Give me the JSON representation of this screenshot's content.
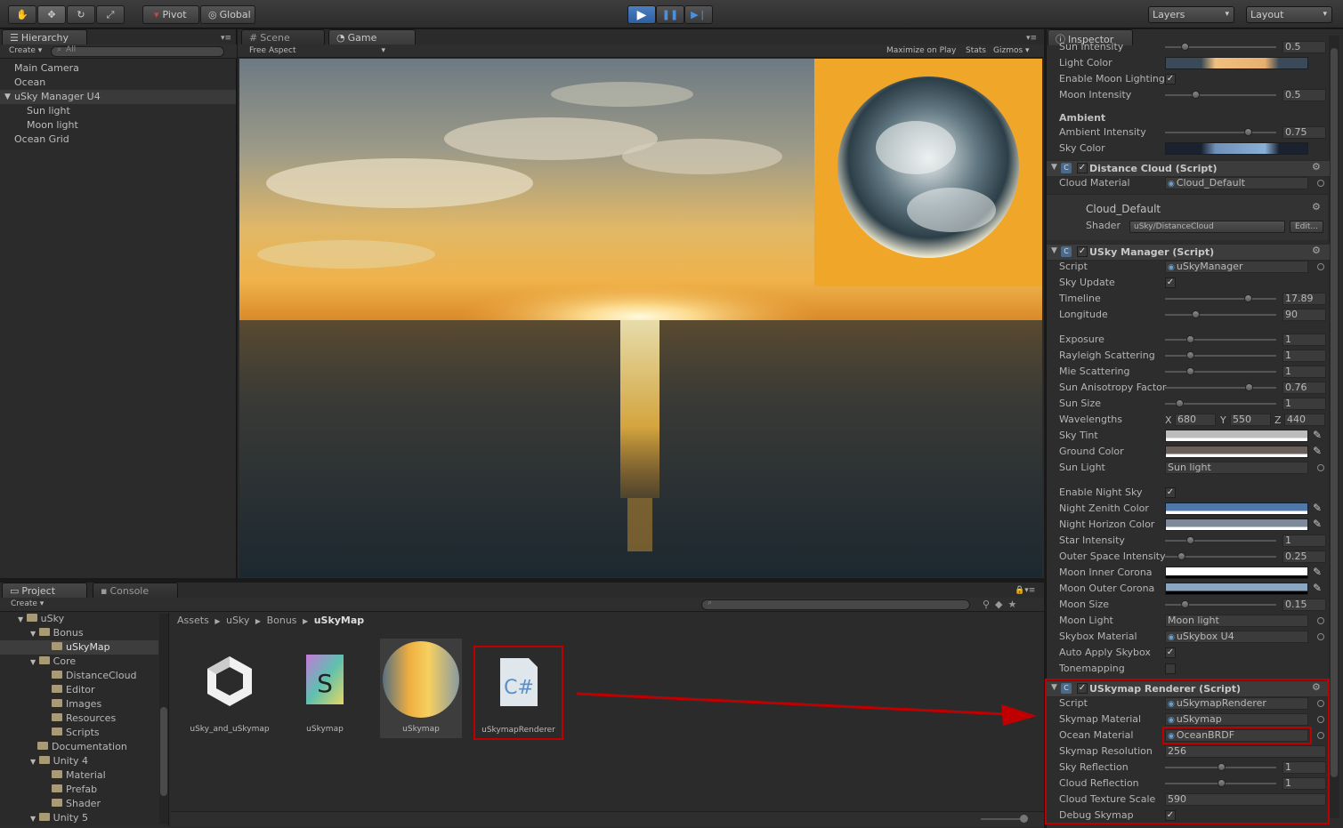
{
  "toolbar": {
    "pivot": "Pivot",
    "global": "Global",
    "layers": "Layers",
    "layout": "Layout"
  },
  "hierarchy": {
    "tab": "Hierarchy",
    "create": "Create",
    "search_placeholder": "All",
    "items": [
      "Main Camera",
      "Ocean",
      "uSky Manager U4",
      "Sun light",
      "Moon light",
      "Ocean Grid"
    ]
  },
  "scene_tab": "Scene",
  "game": {
    "tab": "Game",
    "aspect": "Free Aspect",
    "maximize": "Maximize on Play",
    "stats": "Stats",
    "gizmos": "Gizmos"
  },
  "project": {
    "tab": "Project",
    "console_tab": "Console",
    "create": "Create",
    "tree": [
      "uSky",
      "Bonus",
      "uSkyMap",
      "Core",
      "DistanceCloud",
      "Editor",
      "Images",
      "Resources",
      "Scripts",
      "Documentation",
      "Unity 4",
      "Material",
      "Prefab",
      "Shader",
      "Unity 5"
    ],
    "breadcrumb": [
      "Assets",
      "uSky",
      "Bonus",
      "uSkyMap"
    ],
    "assets": [
      "uSky_and_uSkymap",
      "uSkymap",
      "uSkymap",
      "uSkymapRenderer"
    ]
  },
  "inspector": {
    "tab": "Inspector",
    "rows": [
      {
        "label": "Sun Intensity",
        "value": "0.5"
      },
      {
        "label": "Light Color"
      },
      {
        "label": "Enable Moon Lighting"
      },
      {
        "label": "Moon Intensity",
        "value": "0.5"
      },
      {
        "label": "Ambient"
      },
      {
        "label": "Ambient Intensity",
        "value": "0.75"
      },
      {
        "label": "Sky Color"
      }
    ],
    "distance_cloud": {
      "title": "Distance Cloud (Script)",
      "cloud_material_label": "Cloud Material",
      "cloud_material": "Cloud_Default",
      "material_name": "Cloud_Default",
      "shader_label": "Shader",
      "shader": "uSky/DistanceCloud",
      "edit": "Edit..."
    },
    "manager": {
      "title": "USky Manager (Script)",
      "rows": [
        {
          "label": "Script",
          "field": "uSkyManager"
        },
        {
          "label": "Sky Update"
        },
        {
          "label": "Timeline",
          "value": "17.89"
        },
        {
          "label": "Longitude",
          "value": "90"
        },
        {
          "label": "Exposure",
          "value": "1"
        },
        {
          "label": "Rayleigh Scattering",
          "value": "1"
        },
        {
          "label": "Mie Scattering",
          "value": "1"
        },
        {
          "label": "Sun Anisotropy Factor",
          "value": "0.76"
        },
        {
          "label": "Sun Size",
          "value": "1"
        },
        {
          "label": "Wavelengths"
        },
        {
          "label": "Sky Tint"
        },
        {
          "label": "Ground Color"
        },
        {
          "label": "Sun Light",
          "field": "Sun light"
        },
        {
          "label": "Enable Night Sky"
        },
        {
          "label": "Night Zenith Color"
        },
        {
          "label": "Night Horizon Color"
        },
        {
          "label": "Star Intensity",
          "value": "1"
        },
        {
          "label": "Outer Space Intensity",
          "value": "0.25"
        },
        {
          "label": "Moon Inner Corona"
        },
        {
          "label": "Moon Outer Corona"
        },
        {
          "label": "Moon Size",
          "value": "0.15"
        },
        {
          "label": "Moon Light",
          "field": "Moon light"
        },
        {
          "label": "Skybox Material",
          "field": "uSkybox U4"
        },
        {
          "label": "Auto Apply Skybox"
        },
        {
          "label": "Tonemapping"
        }
      ],
      "wavelengths": {
        "x": "680",
        "y": "550",
        "z": "440",
        "xl": "X",
        "yl": "Y",
        "zl": "Z"
      }
    },
    "renderer": {
      "title": "USkymap Renderer (Script)",
      "rows": [
        {
          "label": "Script",
          "field": "uSkymapRenderer"
        },
        {
          "label": "Skymap Material",
          "field": "uSkymap"
        },
        {
          "label": "Ocean Material",
          "field": "OceanBRDF"
        },
        {
          "label": "Skymap Resolution",
          "field": "256"
        },
        {
          "label": "Sky Reflection",
          "value": "1"
        },
        {
          "label": "Cloud Reflection",
          "value": "1"
        },
        {
          "label": "Cloud Texture Scale",
          "field": "590"
        },
        {
          "label": "Debug Skymap"
        }
      ]
    }
  },
  "colors": {
    "accent": "#c00000",
    "play": "#3b74c4",
    "panel": "#2a2a2a"
  }
}
